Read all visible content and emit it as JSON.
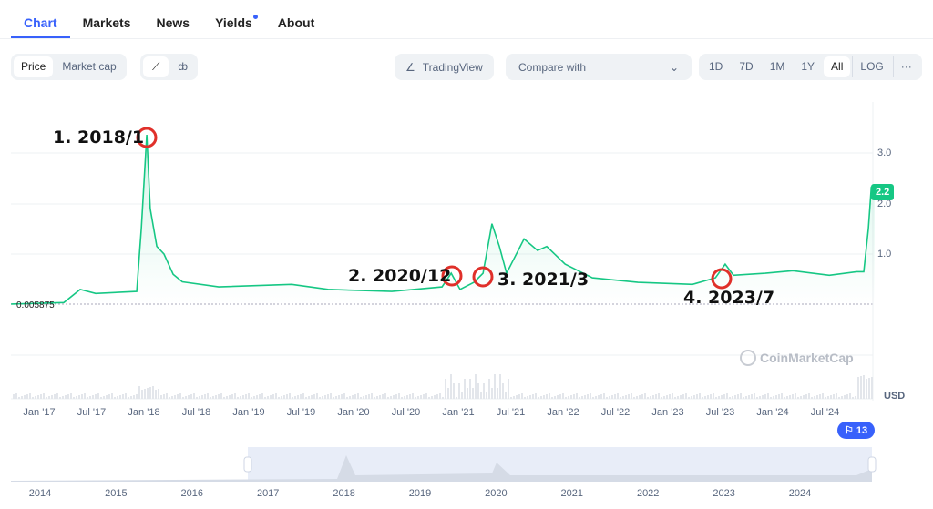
{
  "tabs": [
    {
      "label": "Chart"
    },
    {
      "label": "Markets"
    },
    {
      "label": "News"
    },
    {
      "label": "Yields"
    },
    {
      "label": "About"
    }
  ],
  "toolbar": {
    "price": "Price",
    "market_cap": "Market cap",
    "line_icon": "line-chart-icon",
    "candle_icon": "candlestick-icon",
    "tradingview": "TradingView",
    "compare": "Compare with",
    "ranges": [
      "1D",
      "7D",
      "1M",
      "1Y",
      "All"
    ],
    "log": "LOG",
    "more": "···"
  },
  "chart_data": {
    "type": "line",
    "y_ticks": [
      "3.0",
      "2.0",
      "1.0"
    ],
    "ylim": [
      0,
      3.6
    ],
    "baseline_label": "0.005875",
    "current_price_label": "2.2",
    "currency": "USD",
    "watermark": "CoinMarketCap",
    "line_color": "#16c784",
    "x_ticks": [
      "Jan '17",
      "Jul '17",
      "Jan '18",
      "Jul '18",
      "Jan '19",
      "Jul '19",
      "Jan '20",
      "Jul '20",
      "Jan '21",
      "Jul '21",
      "Jan '22",
      "Jul '22",
      "Jan '23",
      "Jul '23",
      "Jan '24",
      "Jul '24"
    ],
    "points": [
      [
        "2016-09-25",
        0.01
      ],
      [
        "2017-03-28",
        0.04
      ],
      [
        "2017-05-24",
        0.3
      ],
      [
        "2017-07-17",
        0.22
      ],
      [
        "2017-12-07",
        0.26
      ],
      [
        "2017-12-23",
        1.5
      ],
      [
        "2018-01-11",
        3.36
      ],
      [
        "2018-01-23",
        1.9
      ],
      [
        "2018-02-15",
        1.15
      ],
      [
        "2018-03-12",
        1.0
      ],
      [
        "2018-04-13",
        0.6
      ],
      [
        "2018-05-15",
        0.45
      ],
      [
        "2018-09-19",
        0.35
      ],
      [
        "2019-05-31",
        0.4
      ],
      [
        "2019-10-05",
        0.3
      ],
      [
        "2020-05-14",
        0.26
      ],
      [
        "2020-11-05",
        0.35
      ],
      [
        "2020-12-07",
        0.62
      ],
      [
        "2021-01-07",
        0.3
      ],
      [
        "2021-02-24",
        0.44
      ],
      [
        "2021-03-28",
        0.62
      ],
      [
        "2021-04-28",
        1.6
      ],
      [
        "2021-05-24",
        1.15
      ],
      [
        "2021-06-18",
        0.62
      ],
      [
        "2021-08-18",
        1.3
      ],
      [
        "2021-10-04",
        1.07
      ],
      [
        "2021-11-05",
        1.15
      ],
      [
        "2022-01-08",
        0.8
      ],
      [
        "2022-04-13",
        0.53
      ],
      [
        "2022-09-19",
        0.44
      ],
      [
        "2023-03-28",
        0.4
      ],
      [
        "2023-06-16",
        0.53
      ],
      [
        "2023-07-20",
        0.8
      ],
      [
        "2023-08-18",
        0.58
      ],
      [
        "2023-12-07",
        0.62
      ],
      [
        "2024-03-12",
        0.67
      ],
      [
        "2024-07-17",
        0.58
      ],
      [
        "2024-10-20",
        0.65
      ],
      [
        "2024-11-14",
        0.65
      ],
      [
        "2024-11-30",
        1.5
      ],
      [
        "2024-12-10",
        2.3
      ],
      [
        "2024-12-22",
        2.2
      ]
    ],
    "annotations": [
      {
        "label": "1. 2018/1",
        "date": "2018-01-11"
      },
      {
        "label": "2. 2020/12",
        "date": "2020-12-07"
      },
      {
        "label": "3. 2021/3",
        "date": "2021-03-28"
      },
      {
        "label": "4. 2023/7",
        "date": "2023-07-01"
      }
    ],
    "navigator_years": [
      "2014",
      "2015",
      "2016",
      "2017",
      "2018",
      "2019",
      "2020",
      "2021",
      "2022",
      "2023",
      "2024"
    ],
    "events_badge": "13"
  }
}
